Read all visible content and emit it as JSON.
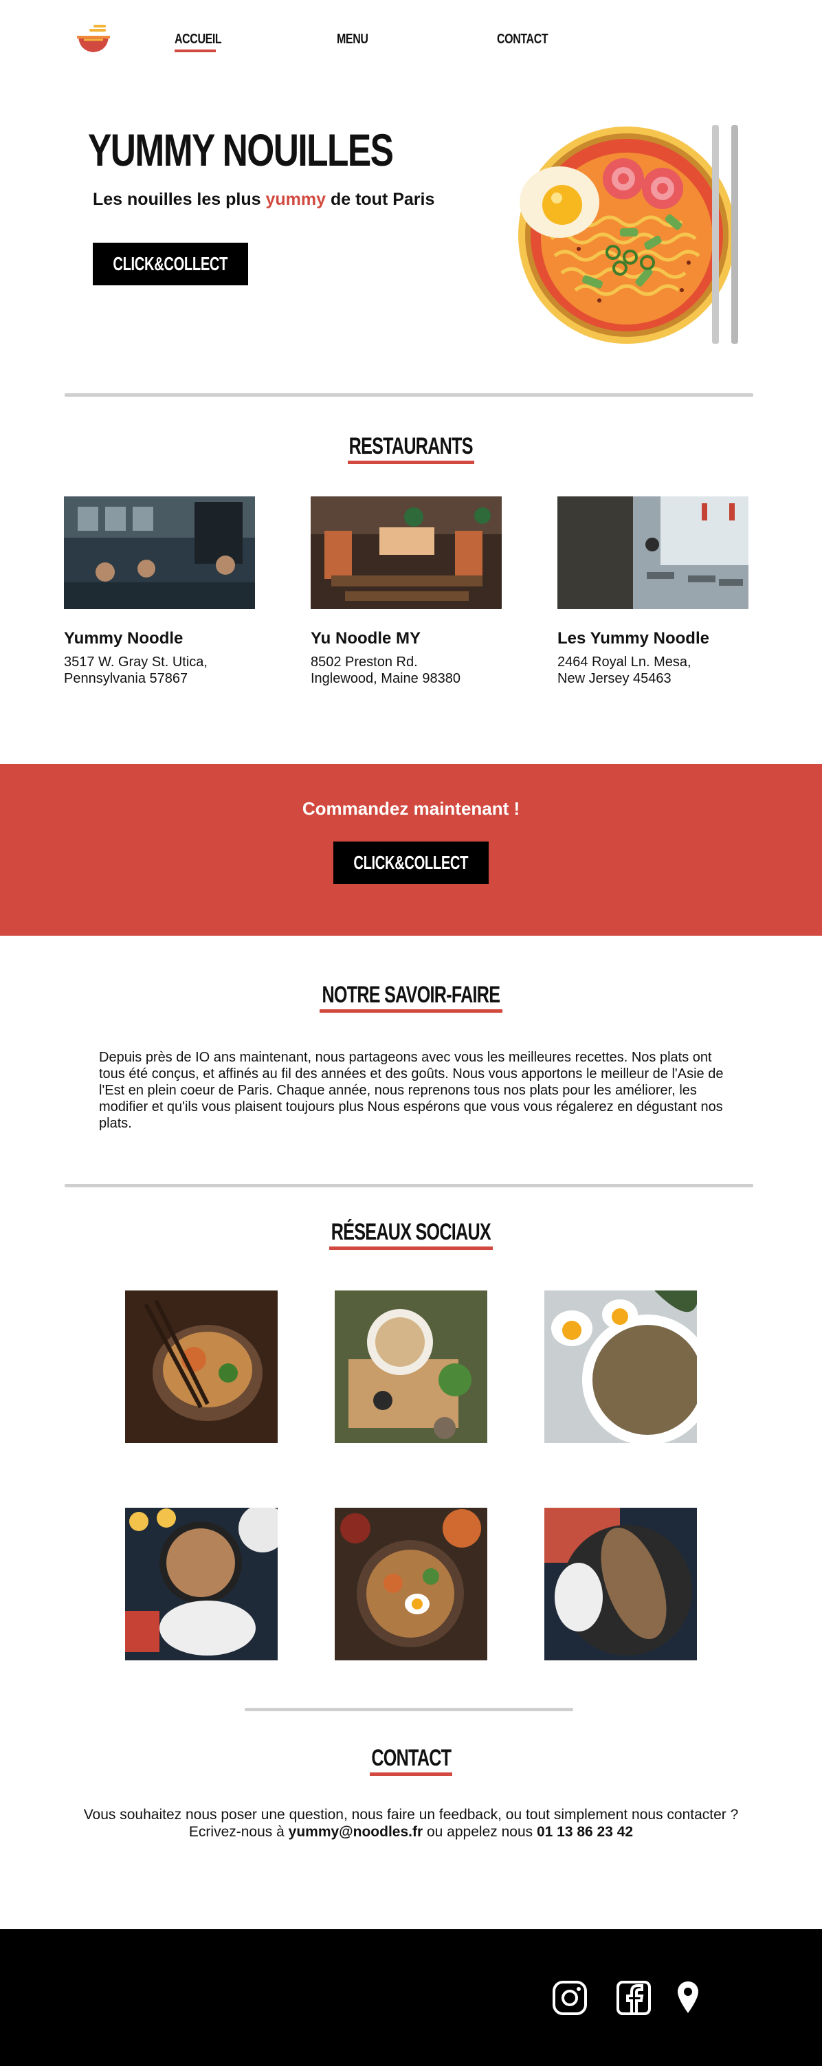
{
  "nav": {
    "logo": "ramen-logo",
    "links": [
      {
        "label": "ACCUEIL",
        "active": true
      },
      {
        "label": "MENU",
        "active": false
      },
      {
        "label": "CONTACT",
        "active": false
      }
    ]
  },
  "hero": {
    "title": "YUMMY NOUILLES",
    "subtitle_before": "Les nouilles les plus ",
    "subtitle_accent": "yummy",
    "subtitle_after": " de tout Paris",
    "button": "CLICK&COLLECT",
    "image": "ramen-bowl-illustration"
  },
  "restaurants": {
    "title": "RESTAURANTS",
    "items": [
      {
        "name": "Yummy Noodle",
        "address": "3517 W. Gray St. Utica, Pennsylvania 57867"
      },
      {
        "name": "Yu Noodle MY",
        "address": "8502 Preston Rd. Inglewood, Maine 98380"
      },
      {
        "name": "Les Yummy Noodle",
        "address": "2464 Royal Ln. Mesa, New Jersey 45463"
      }
    ]
  },
  "cta": {
    "text": "Commandez maintenant !",
    "button": "CLICK&COLLECT"
  },
  "savoir": {
    "title": "NOTRE SAVOIR-FAIRE",
    "text": "Depuis près de IO ans maintenant, nous partageons avec vous les meilleures recettes. Nos plats ont tous été conçus, et affinés au fil des années et des goûts. Nous vous apportons le meilleur de l'Asie de l'Est en plein coeur de Paris. Chaque année, nous reprenons tous nos plats pour les améliorer, les modifier et qu'ils vous plaisent toujours plus Nous espérons que vous vous régalerez en dégustant nos plats."
  },
  "social": {
    "title": "RÉSEAUX SOCIAUX",
    "photos": [
      "ramen-chopsticks-photo",
      "noodle-table-photo",
      "egg-soup-photo",
      "sushi-platter-photo",
      "ramen-topdown-photo",
      "grilled-fish-photo"
    ]
  },
  "contact": {
    "title": "CONTACT",
    "line1": "Vous souhaitez nous poser une question, nous faire un feedback, ou tout simplement nous contacter ?",
    "line2_before": "Ecrivez-nous à ",
    "email": "yummy@noodles.fr",
    "line2_middle": " ou appelez nous ",
    "phone": "01 13 86 23 42"
  },
  "footer": {
    "icons": [
      "instagram-icon",
      "facebook-icon",
      "location-pin-icon"
    ]
  },
  "colors": {
    "accent": "#d24a3f",
    "black": "#000000",
    "divider": "#cfcfcf"
  }
}
